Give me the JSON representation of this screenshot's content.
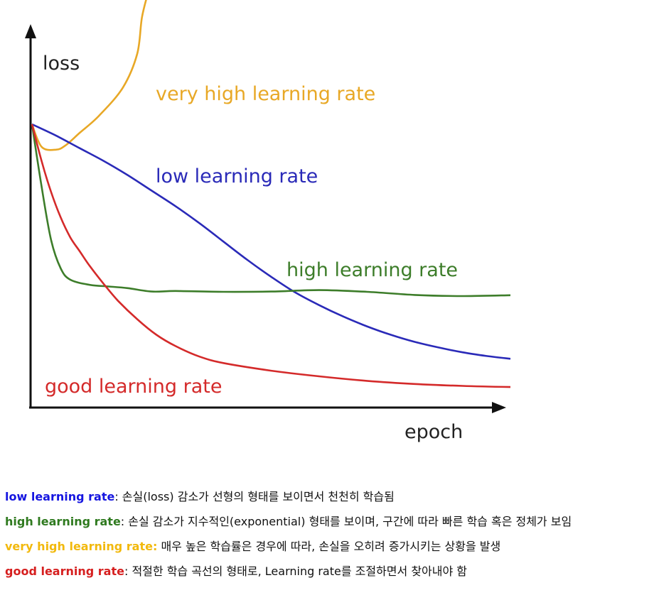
{
  "chart_data": {
    "type": "line",
    "title": "",
    "xlabel": "epoch",
    "ylabel": "loss",
    "xlim": [
      0,
      100
    ],
    "ylim": [
      0,
      100
    ],
    "grid": false,
    "legend": "inline labels",
    "series": [
      {
        "name": "very high learning rate",
        "color": "#e8a826",
        "x": [
          0,
          2,
          5,
          7,
          10,
          14,
          19,
          22,
          23,
          24.5
        ],
        "y": [
          100,
          92,
          91,
          92.5,
          97,
          103,
          113,
          125,
          138,
          148
        ]
      },
      {
        "name": "low learning rate",
        "color": "#2a2ab8",
        "x": [
          0,
          5,
          10,
          15,
          20,
          25,
          30,
          35,
          40,
          45,
          50,
          55,
          60,
          65,
          70,
          75,
          80,
          85,
          90,
          95,
          100
        ],
        "y": [
          100,
          96,
          91.5,
          87,
          82,
          76.5,
          71,
          65,
          58.5,
          52,
          46,
          40.5,
          36,
          32,
          28.5,
          25.5,
          23,
          21,
          19.3,
          18,
          17
        ]
      },
      {
        "name": "high learning rate",
        "color": "#3d7d2a",
        "x": [
          0,
          2,
          4,
          6,
          8,
          12,
          16,
          20,
          25,
          30,
          40,
          50,
          60,
          70,
          80,
          90,
          100
        ],
        "y": [
          100,
          78,
          59,
          49,
          45,
          43.2,
          42.6,
          42,
          40.8,
          41,
          40.7,
          40.8,
          41.3,
          40.7,
          39.6,
          39.2,
          39.5
        ]
      },
      {
        "name": "good learning rate",
        "color": "#d42a2a",
        "x": [
          0,
          2,
          4,
          6,
          8,
          10,
          12,
          15,
          18,
          22,
          26,
          30,
          35,
          40,
          50,
          60,
          70,
          80,
          90,
          100
        ],
        "y": [
          100,
          87,
          76,
          67,
          60,
          55,
          50,
          43.5,
          37.5,
          31,
          25.5,
          21.5,
          17.8,
          15.5,
          12.8,
          10.8,
          9.2,
          8.1,
          7.4,
          7
        ]
      }
    ]
  },
  "notes": [
    {
      "term": "low learning rate",
      "sep": ":",
      "desc": " 손실(loss) 감소가 선형의 형태를 보이면서 천천히 학습됨",
      "color": "#1515e0"
    },
    {
      "term": "high learning rate",
      "sep": ":",
      "desc": " 손실 감소가 지수적인(exponential) 형태를 보이며, 구간에 따라 빠른 학습 혹은 정체가 보임",
      "color": "#2f7a1f"
    },
    {
      "term": "very high learning rate:",
      "sep": "",
      "desc": " 매우 높은 학습률은 경우에 따라, 손실을 오히려 증가시키는 상황을 발생",
      "color": "#f2b90d"
    },
    {
      "term": "good learning rate",
      "sep": ":",
      "desc": "  적절한 학습 곡선의 형태로, Learning rate를 조절하면서 찾아내야 함",
      "color": "#d61f1f"
    }
  ]
}
